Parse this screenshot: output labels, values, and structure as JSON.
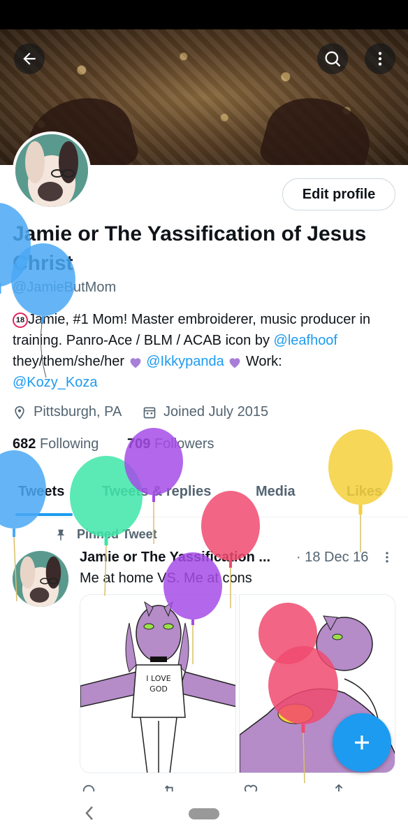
{
  "profile": {
    "name": "Jamie or The Yassification of Jesus Christ",
    "handle": "@JamieButMom",
    "edit_label": "Edit profile",
    "bio": {
      "line1_text": "Jamie, #1 Mom! Master embroiderer, music producer in training. Panro-Ace / BLM / ACAB icon by ",
      "line1_link": "@leafhoof",
      "line2_text": "they/them/she/her",
      "link2": "@Ikkypanda",
      "work_label": "Work:",
      "link3": "@Kozy_Koza",
      "adult_badge": "18"
    },
    "location": "Pittsburgh, PA",
    "joined": "Joined July 2015",
    "following_count": "682",
    "following_label": "Following",
    "followers_count": "709",
    "followers_label": "Followers"
  },
  "tabs": [
    {
      "label": "Tweets"
    },
    {
      "label": "Tweets & replies"
    },
    {
      "label": "Media"
    },
    {
      "label": "Likes"
    }
  ],
  "tweet": {
    "pinned_label": "Pinned Tweet",
    "author": "Jamie or The Yassification ...",
    "date": "· 18 Dec 16",
    "text": "Me at home VS. Me at cons",
    "sign_text_line1": "I LOVE",
    "sign_text_line2": "GOD"
  },
  "colors": {
    "accent": "#1d9bf0",
    "text": "#0f1419",
    "muted": "#536471",
    "balloon_blue": "#4aa8f5",
    "balloon_green": "#3ee6a8",
    "balloon_purple": "#a64ce8",
    "balloon_red": "#f04a6e",
    "balloon_yellow": "#f5d03a"
  },
  "icons": {
    "back": "arrow-left-icon",
    "search": "search-icon",
    "more": "more-vertical-icon",
    "location": "location-pin-icon",
    "calendar": "calendar-icon",
    "pin": "pin-icon",
    "compose": "plus-icon"
  }
}
